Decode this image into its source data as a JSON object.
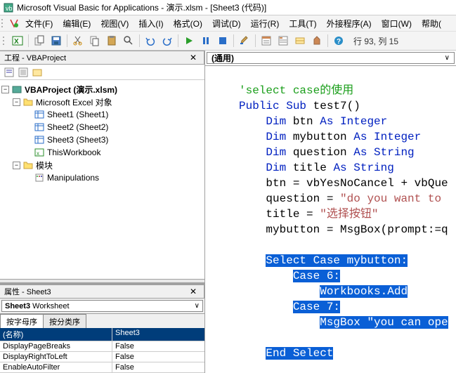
{
  "window": {
    "title": "Microsoft Visual Basic for Applications - 演示.xlsm - [Sheet3 (代码)]"
  },
  "menu": [
    "文件(F)",
    "编辑(E)",
    "视图(V)",
    "插入(I)",
    "格式(O)",
    "调试(D)",
    "运行(R)",
    "工具(T)",
    "外接程序(A)",
    "窗口(W)",
    "帮助("
  ],
  "toolbar_status": "行 93, 列 15",
  "project_pane": {
    "title": "工程 - VBAProject",
    "root": "VBAProject (演示.xlsm)",
    "excel_folder": "Microsoft Excel 对象",
    "sheets": [
      "Sheet1 (Sheet1)",
      "Sheet2 (Sheet2)",
      "Sheet3 (Sheet3)",
      "ThisWorkbook"
    ],
    "modules_folder": "模块",
    "modules": [
      "Manipulations"
    ]
  },
  "props_pane": {
    "title": "属性 - Sheet3",
    "object": "Sheet3 Worksheet",
    "tabs": [
      "按字母序",
      "按分类序"
    ],
    "header": "(名称)",
    "header_val": "Sheet3",
    "rows": [
      {
        "k": "DisplayPageBreaks",
        "v": "False"
      },
      {
        "k": "DisplayRightToLeft",
        "v": "False"
      },
      {
        "k": "EnableAutoFilter",
        "v": "False"
      }
    ]
  },
  "code_dd": "(通用)",
  "code": {
    "l1": "'select case的使用",
    "l2a": "Public",
    "l2b": "Sub",
    "l2c": " test7()",
    "l3a": "Dim",
    "l3b": " btn ",
    "l3c": "As",
    "l3d": " Integer",
    "l4a": "Dim",
    "l4b": " mybutton ",
    "l4c": "As",
    "l4d": " Integer",
    "l5a": "Dim",
    "l5b": " question ",
    "l5c": "As",
    "l5d": " String",
    "l6a": "Dim",
    "l6b": " title ",
    "l6c": "As",
    "l6d": " String",
    "l7": "btn = vbYesNoCancel + vbQue",
    "l8a": "question = ",
    "l8b": "\"do you want to ",
    "l9a": "title = ",
    "l9b": "\"选择按钮\"",
    "l10": "mybutton = MsgBox(prompt:=q",
    "h1a": "Select",
    "h1b": " Case mybutton:",
    "h2": "Case 6:",
    "h3": "Workbooks.Add",
    "h4": "Case 7:",
    "h5a": "MsgBox ",
    "h5b": "\"you can ope",
    "h6a": "End",
    "h6b": " Select"
  }
}
